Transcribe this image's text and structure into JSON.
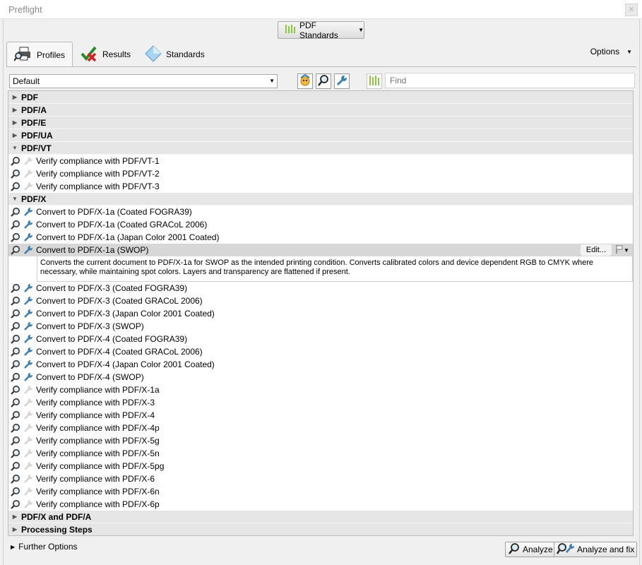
{
  "window": {
    "title": "Preflight"
  },
  "header": {
    "standards_button": "PDF Standards"
  },
  "tabs": [
    {
      "label": "Profiles",
      "icon": "printer-magnifier-icon",
      "active": true
    },
    {
      "label": "Results",
      "icon": "checkmark-x-icon",
      "active": false
    },
    {
      "label": "Standards",
      "icon": "diamond-icon",
      "active": false
    }
  ],
  "options_label": "Options",
  "toolbar": {
    "library_value": "Default",
    "find_placeholder": "Find"
  },
  "groups_top": [
    {
      "label": "PDF"
    },
    {
      "label": "PDF/A"
    },
    {
      "label": "PDF/E"
    },
    {
      "label": "PDF/UA"
    }
  ],
  "group_vt": {
    "label": "PDF/VT"
  },
  "vt_items": [
    {
      "label": "Verify compliance with PDF/VT-1"
    },
    {
      "label": "Verify compliance with PDF/VT-2"
    },
    {
      "label": "Verify compliance with PDF/VT-3"
    }
  ],
  "group_x": {
    "label": "PDF/X"
  },
  "x_items_before": [
    {
      "label": "Convert to PDF/X-1a (Coated FOGRA39)"
    },
    {
      "label": "Convert to PDF/X-1a (Coated GRACoL 2006)"
    },
    {
      "label": "Convert to PDF/X-1a (Japan Color 2001 Coated)"
    }
  ],
  "selected": {
    "label": "Convert to PDF/X-1a (SWOP)",
    "edit_label": "Edit...",
    "description": "Converts the current document to PDF/X-1a for SWOP as the intended printing condition. Converts calibrated colors and device dependent RGB to CMYK where necessary, while maintaining spot colors. Layers and transparency are flattened if present."
  },
  "x_items_fix": [
    {
      "label": "Convert to PDF/X-3 (Coated FOGRA39)"
    },
    {
      "label": "Convert to PDF/X-3 (Coated GRACoL 2006)"
    },
    {
      "label": "Convert to PDF/X-3 (Japan Color 2001 Coated)"
    },
    {
      "label": "Convert to PDF/X-3 (SWOP)"
    },
    {
      "label": "Convert to PDF/X-4 (Coated FOGRA39)"
    },
    {
      "label": "Convert to PDF/X-4 (Coated GRACoL 2006)"
    },
    {
      "label": "Convert to PDF/X-4 (Japan Color 2001 Coated)"
    },
    {
      "label": "Convert to PDF/X-4 (SWOP)"
    }
  ],
  "x_items_verify": [
    {
      "label": "Verify compliance with PDF/X-1a"
    },
    {
      "label": "Verify compliance with PDF/X-3"
    },
    {
      "label": "Verify compliance with PDF/X-4"
    },
    {
      "label": "Verify compliance with PDF/X-4p"
    },
    {
      "label": "Verify compliance with PDF/X-5g"
    },
    {
      "label": "Verify compliance with PDF/X-5n"
    },
    {
      "label": "Verify compliance with PDF/X-5pg"
    },
    {
      "label": "Verify compliance with PDF/X-6"
    },
    {
      "label": "Verify compliance with PDF/X-6n"
    },
    {
      "label": "Verify compliance with PDF/X-6p"
    }
  ],
  "groups_bottom": [
    {
      "label": "PDF/X and PDF/A"
    },
    {
      "label": "Processing Steps"
    }
  ],
  "footer": {
    "further_options": "Further Options",
    "analyze": "Analyze",
    "analyze_fix": "Analyze and fix"
  },
  "colors": {
    "selection": "#d7d7d7",
    "group_bg": "#e6e6e6",
    "icon_blue": "#3c7fb1",
    "bars_green": "#8dc63f"
  }
}
